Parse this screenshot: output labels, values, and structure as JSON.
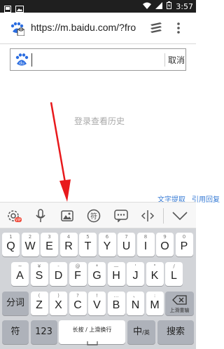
{
  "status": {
    "time": "3:57"
  },
  "browser": {
    "url": "https://m.baidu.com/?fro",
    "logo_text": "du"
  },
  "search": {
    "cancel": "取消"
  },
  "history": {
    "empty_text": "登录查看历史"
  },
  "links": {
    "text_extract": "文字提取",
    "quote_reply": "引用回复"
  },
  "toolbar": {
    "vip_badge": "VIP"
  },
  "keyboard": {
    "row1": [
      {
        "sub": "1",
        "main": "Q"
      },
      {
        "sub": "2",
        "main": "W"
      },
      {
        "sub": "3",
        "main": "E"
      },
      {
        "sub": "4",
        "main": "R"
      },
      {
        "sub": "5",
        "main": "T"
      },
      {
        "sub": "6",
        "main": "Y"
      },
      {
        "sub": "7",
        "main": "U"
      },
      {
        "sub": "8",
        "main": "I"
      },
      {
        "sub": "9",
        "main": "O"
      },
      {
        "sub": "0",
        "main": "P"
      }
    ],
    "row2": [
      {
        "sub": "~",
        "main": "A"
      },
      {
        "sub": "¥",
        "main": "S"
      },
      {
        "sub": "-",
        "main": "D"
      },
      {
        "sub": "@",
        "main": "F"
      },
      {
        "sub": "*",
        "main": "G"
      },
      {
        "sub": "—",
        "main": "H"
      },
      {
        "sub": "'",
        "main": "J"
      },
      {
        "sub": "\"",
        "main": "K"
      },
      {
        "sub": "/",
        "main": "L"
      }
    ],
    "row3": [
      {
        "sub": "(",
        "main": "Z"
      },
      {
        "sub": ")",
        "main": "X"
      },
      {
        "sub": "?",
        "main": "C"
      },
      {
        "sub": "!",
        "main": "V"
      },
      {
        "sub": "…",
        "main": "B"
      },
      {
        "sub": "、",
        "main": "N"
      },
      {
        "sub": ":",
        "main": "M"
      }
    ],
    "fenci": "分词",
    "backspace_sub": "上滑重输",
    "sym": "符",
    "num": "123",
    "space": "长按 / 上滑换行",
    "lang_main": "中",
    "lang_sub": "/英",
    "search": "搜索"
  }
}
